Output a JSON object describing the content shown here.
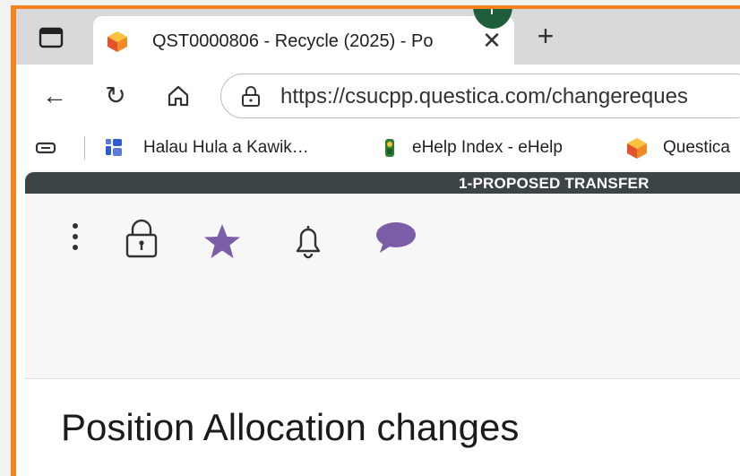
{
  "browser": {
    "tab": {
      "title": "QST0000806 - Recycle (2025) - Po",
      "close_label": "✕"
    },
    "new_tab_label": "+",
    "nav": {
      "back_label": "←",
      "reload_label": "↻",
      "home_label": "⌂"
    },
    "url": "https://csucpp.questica.com/changereques",
    "bookmarks": [
      {
        "label": "Halau Hula a Kawik…",
        "icon": "bookmark-app-icon"
      },
      {
        "label": "eHelp Index - eHelp",
        "icon": "ehelp-icon"
      },
      {
        "label": "Questica",
        "icon": "questica-icon"
      }
    ]
  },
  "page": {
    "banner": "1-PROPOSED TRANSFER",
    "actions": [
      {
        "name": "more-menu",
        "icon": "vertical-dots-icon"
      },
      {
        "name": "lock",
        "icon": "lock-icon"
      },
      {
        "name": "favorite",
        "icon": "star-icon"
      },
      {
        "name": "notifications",
        "icon": "bell-icon"
      },
      {
        "name": "comments",
        "icon": "chat-icon"
      }
    ],
    "section_title": "Position Allocation changes"
  },
  "colors": {
    "frame": "#f4821f",
    "banner": "#3d4448",
    "accent_purple": "#7b5ea7",
    "badge_green": "#1e5e3a"
  }
}
